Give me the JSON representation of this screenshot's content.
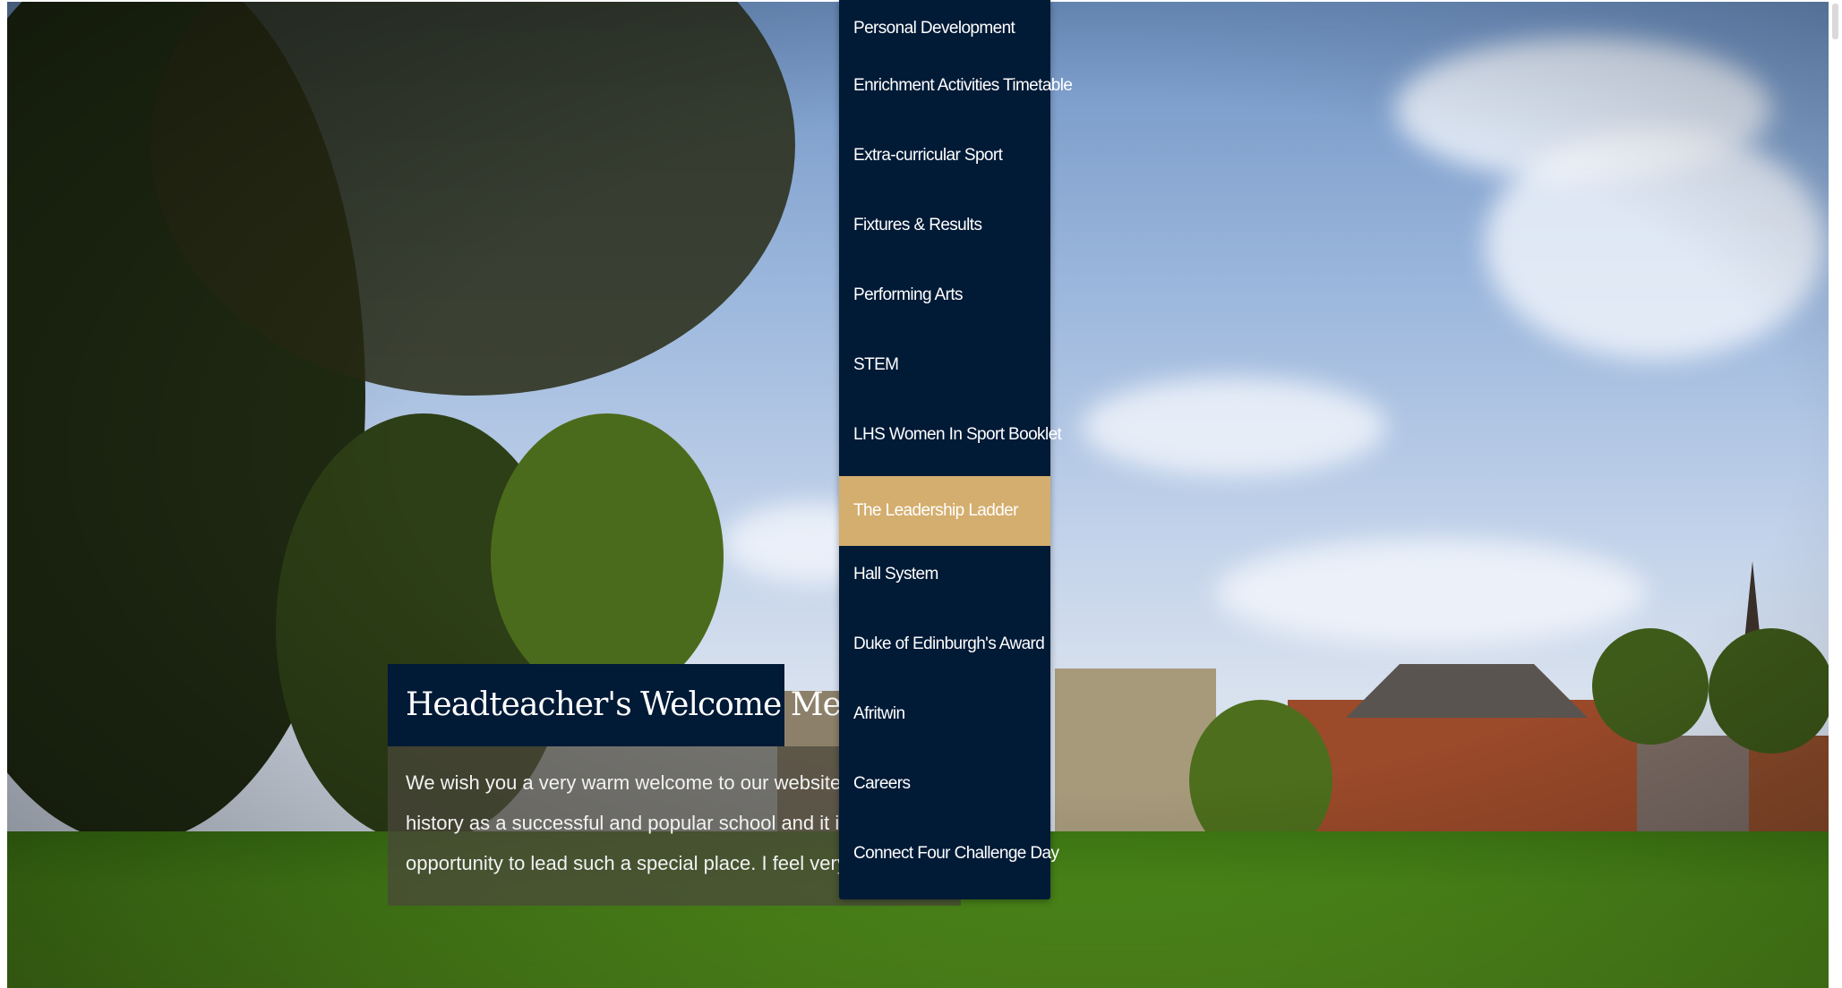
{
  "welcome": {
    "title": "Headteacher's Welcome Message",
    "lines": [
      "We wish you a very warm welcome to our website. Lymm High School",
      "history as a successful and popular school and it is a real honour to h",
      "opportunity to lead such a special place. I feel very fortunate indeed to"
    ]
  },
  "menu": {
    "items": [
      {
        "label": "Personal Development"
      },
      {
        "label": "Enrichment Activities Timetable"
      },
      {
        "label": "Extra-curricular Sport"
      },
      {
        "label": "Fixtures & Results"
      },
      {
        "label": "Performing Arts"
      },
      {
        "label": "STEM"
      },
      {
        "label": "LHS Women In Sport Booklet"
      },
      {
        "label": "The Leadership Ladder"
      },
      {
        "label": "Hall System"
      },
      {
        "label": "Duke of Edinburgh's Award"
      },
      {
        "label": "Afritwin"
      },
      {
        "label": "Careers"
      },
      {
        "label": "Connect Four Challenge Day"
      }
    ],
    "active_label": "The Leadership Ladder"
  },
  "colors": {
    "menu_background": "#011a36",
    "menu_active": "#d4ae6e",
    "title_background": "#011a36"
  }
}
